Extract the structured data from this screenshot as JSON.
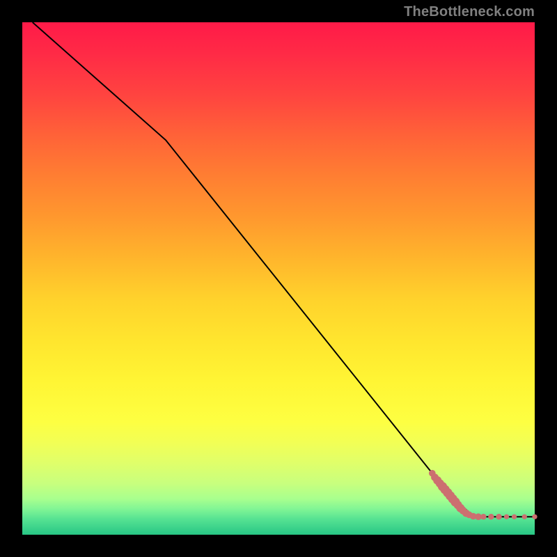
{
  "branding": "TheBottleneck.com",
  "chart_data": {
    "type": "line",
    "title": "",
    "xlabel": "",
    "ylabel": "",
    "xlim": [
      0,
      100
    ],
    "ylim": [
      0,
      100
    ],
    "curve": [
      {
        "x": 2,
        "y": 100
      },
      {
        "x": 28,
        "y": 77
      },
      {
        "x": 82,
        "y": 9.5
      },
      {
        "x": 88,
        "y": 3.5
      },
      {
        "x": 100,
        "y": 3.5
      }
    ],
    "scatter": [
      {
        "x": 80.0,
        "y": 12.0,
        "r": 0.8
      },
      {
        "x": 80.5,
        "y": 11.2,
        "r": 0.9
      },
      {
        "x": 81.0,
        "y": 10.6,
        "r": 1.0
      },
      {
        "x": 81.5,
        "y": 10.0,
        "r": 1.0
      },
      {
        "x": 82.0,
        "y": 9.4,
        "r": 1.1
      },
      {
        "x": 82.5,
        "y": 8.8,
        "r": 1.1
      },
      {
        "x": 83.0,
        "y": 8.2,
        "r": 1.1
      },
      {
        "x": 83.5,
        "y": 7.6,
        "r": 1.1
      },
      {
        "x": 84.0,
        "y": 7.0,
        "r": 1.1
      },
      {
        "x": 84.5,
        "y": 6.4,
        "r": 1.1
      },
      {
        "x": 85.0,
        "y": 5.8,
        "r": 1.0
      },
      {
        "x": 85.5,
        "y": 5.2,
        "r": 1.0
      },
      {
        "x": 86.0,
        "y": 4.7,
        "r": 0.9
      },
      {
        "x": 86.6,
        "y": 4.2,
        "r": 0.9
      },
      {
        "x": 87.2,
        "y": 3.9,
        "r": 0.8
      },
      {
        "x": 88.0,
        "y": 3.6,
        "r": 0.8
      },
      {
        "x": 89.0,
        "y": 3.5,
        "r": 0.8
      },
      {
        "x": 90.0,
        "y": 3.5,
        "r": 0.7
      },
      {
        "x": 91.5,
        "y": 3.5,
        "r": 0.7
      },
      {
        "x": 93.0,
        "y": 3.5,
        "r": 0.7
      },
      {
        "x": 94.5,
        "y": 3.5,
        "r": 0.6
      },
      {
        "x": 96.0,
        "y": 3.5,
        "r": 0.6
      },
      {
        "x": 98.0,
        "y": 3.5,
        "r": 0.6
      },
      {
        "x": 100.0,
        "y": 3.5,
        "r": 0.6
      }
    ]
  },
  "colors": {
    "dot": "#cc6f70",
    "curve": "#000000"
  }
}
